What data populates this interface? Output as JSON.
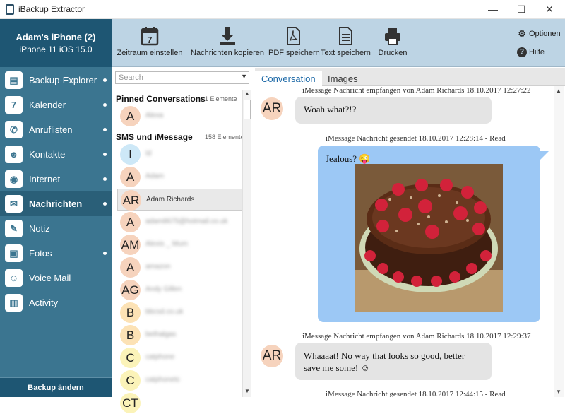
{
  "window": {
    "title": "iBackup Extractor",
    "controls": [
      "—",
      "☐",
      "✕"
    ]
  },
  "device": {
    "name": "Adam's iPhone (2)",
    "model": "iPhone 11 iOS 15.0"
  },
  "sidebar": {
    "items": [
      {
        "label": "Backup-Explorer",
        "icon": "backup-icon",
        "glyph": "▤",
        "dot": true,
        "active": false
      },
      {
        "label": "Kalender",
        "icon": "calendar-icon",
        "glyph": "7",
        "dot": true,
        "active": false
      },
      {
        "label": "Anruflisten",
        "icon": "phone-icon",
        "glyph": "✆",
        "dot": true,
        "active": false
      },
      {
        "label": "Kontakte",
        "icon": "contacts-icon",
        "glyph": "☻",
        "dot": true,
        "active": false
      },
      {
        "label": "Internet",
        "icon": "internet-icon",
        "glyph": "◉",
        "dot": true,
        "active": false
      },
      {
        "label": "Nachrichten",
        "icon": "messages-icon",
        "glyph": "✉",
        "dot": true,
        "active": true
      },
      {
        "label": "Notiz",
        "icon": "note-icon",
        "glyph": "✎",
        "dot": false,
        "active": false
      },
      {
        "label": "Fotos",
        "icon": "photos-icon",
        "glyph": "▣",
        "dot": true,
        "active": false
      },
      {
        "label": "Voice Mail",
        "icon": "voicemail-icon",
        "glyph": "☺",
        "dot": false,
        "active": false
      },
      {
        "label": "Activity",
        "icon": "activity-icon",
        "glyph": "▥",
        "dot": false,
        "active": false
      }
    ],
    "backup_change": "Backup ändern"
  },
  "toolbar": {
    "buttons": [
      {
        "label": "Zeitraum einstellen",
        "icon": "calendar-7-icon"
      },
      {
        "label": "Nachrichten kopieren",
        "icon": "download-icon"
      },
      {
        "label": "PDF speichern",
        "icon": "pdf-icon"
      },
      {
        "label": "Text speichern",
        "icon": "text-document-icon"
      },
      {
        "label": "Drucken",
        "icon": "printer-icon"
      }
    ],
    "options_label": "Optionen",
    "help_label": "Hilfe"
  },
  "list": {
    "search_placeholder": "Search",
    "pinned_header": "Pinned Conversations",
    "pinned_count": "1 Elemente",
    "sms_header": "SMS und iMessage",
    "sms_count": "158 Elemente",
    "pinned": [
      {
        "initials": "A",
        "name": "Alexa",
        "color": "#f6d3bd"
      }
    ],
    "conversations": [
      {
        "initials": "I",
        "name": "Id",
        "color": "#cde8f7"
      },
      {
        "initials": "A",
        "name": "Adam",
        "color": "#f6d3bd"
      },
      {
        "initials": "AR",
        "name": "Adam Richards",
        "color": "#f6d3bd",
        "selected": true
      },
      {
        "initials": "A",
        "name": "adam8675@hotmail.co.uk",
        "color": "#f6d3bd"
      },
      {
        "initials": "AM",
        "name": "Alexis _ Mum",
        "color": "#f6d3bd"
      },
      {
        "initials": "A",
        "name": "amazon",
        "color": "#f6d3bd"
      },
      {
        "initials": "AG",
        "name": "Andy Gillen",
        "color": "#f6d3bd"
      },
      {
        "initials": "B",
        "name": "bbcsd.co.uk",
        "color": "#fce2b5"
      },
      {
        "initials": "B",
        "name": "bethalgas",
        "color": "#fce2b5"
      },
      {
        "initials": "C",
        "name": "catphone",
        "color": "#fbf3b9"
      },
      {
        "initials": "C",
        "name": "catphonetc",
        "color": "#fbf3b9"
      },
      {
        "initials": "CT",
        "name": "",
        "color": "#fbf3b9"
      }
    ]
  },
  "chat": {
    "tabs": [
      "Conversation",
      "Images"
    ],
    "messages": [
      {
        "meta": "iMessage Nachricht empfangen von Adam Richards 18.10.2017 12:27:22",
        "text": "Woah what?!?",
        "direction": "in",
        "avatar": "AR"
      },
      {
        "meta": "iMessage Nachricht gesendet 18.10.2017 12:28:14 - Read",
        "text": "Jealous? 😜",
        "direction": "out",
        "has_image": true
      },
      {
        "meta": "iMessage Nachricht empfangen von Adam Richards 18.10.2017 12:29:37",
        "text_line1": "Whaaaat! No way that looks so good, better",
        "text_line2": "save me some! ☺",
        "direction": "in",
        "avatar": "AR"
      },
      {
        "meta": "iMessage Nachricht gesendet 18.10.2017 12:44:15 - Read",
        "direction": "out"
      }
    ]
  },
  "colors": {
    "sidebar": "#3b7590",
    "sidebar_dark": "#1e5673",
    "toolbar": "#bdd4e4",
    "bubble_out": "#9cc8f5",
    "bubble_in": "#e4e4e4",
    "tab_active_text": "#1e6aa8"
  }
}
